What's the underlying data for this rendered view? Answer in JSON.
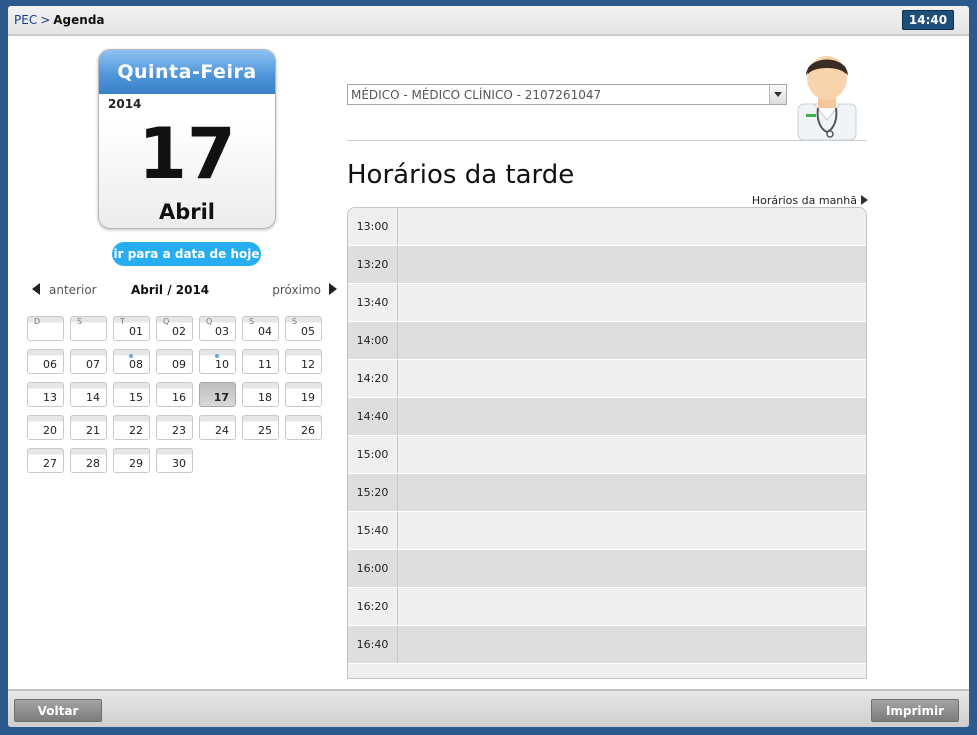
{
  "topbar": {
    "breadcrumb_root": "PEC",
    "breadcrumb_sep": ">",
    "breadcrumb_current": "Agenda",
    "clock": "14:40"
  },
  "day_tile": {
    "weekday": "Quinta-Feira",
    "year": "2014",
    "day": "17",
    "month": "Abril"
  },
  "today_button": "ir para a data de hoje",
  "month_nav": {
    "prev": "anterior",
    "label": "Abril / 2014",
    "next": "próximo"
  },
  "calendar": {
    "weekday_letters": [
      "D",
      "S",
      "T",
      "Q",
      "Q",
      "S",
      "S"
    ],
    "selected_day": "17",
    "marked_days": [
      "08",
      "10"
    ],
    "weeks": [
      [
        "",
        "",
        "01",
        "02",
        "03",
        "04",
        "05"
      ],
      [
        "06",
        "07",
        "08",
        "09",
        "10",
        "11",
        "12"
      ],
      [
        "13",
        "14",
        "15",
        "16",
        "17",
        "18",
        "19"
      ],
      [
        "20",
        "21",
        "22",
        "23",
        "24",
        "25",
        "26"
      ],
      [
        "27",
        "28",
        "29",
        "30",
        "",
        "",
        ""
      ]
    ]
  },
  "professional_select": {
    "value": "MÉDICO - MÉDICO CLÍNICO - 2107261047"
  },
  "section_title": "Horários da tarde",
  "morning_link": "Horários da manhã",
  "slots": [
    "13:00",
    "13:20",
    "13:40",
    "14:00",
    "14:20",
    "14:40",
    "15:00",
    "15:20",
    "15:40",
    "16:00",
    "16:20",
    "16:40"
  ],
  "buttons": {
    "back": "Voltar",
    "print": "Imprimir"
  },
  "colors": {
    "header_blue": "#1f4e79",
    "today_button": "#27aef2",
    "weekday_banner": "#4d93d8"
  }
}
